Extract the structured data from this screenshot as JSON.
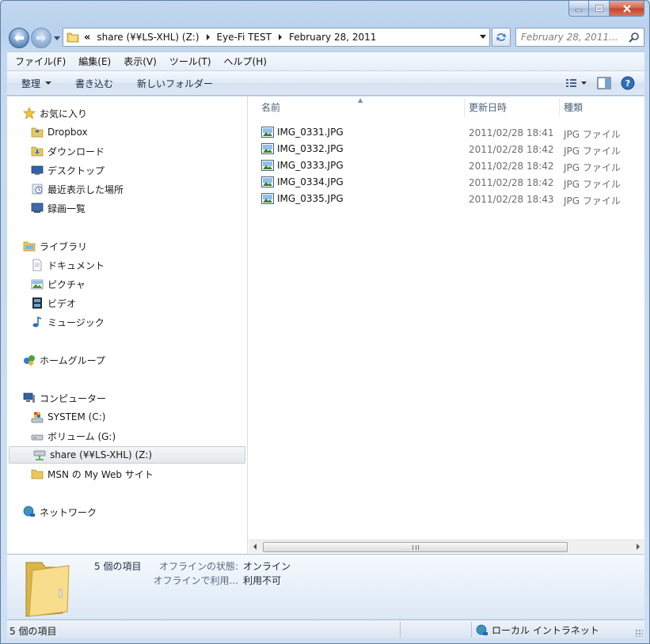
{
  "window": {
    "caption": {
      "minimize": "minimize",
      "maximize": "maximize",
      "close": "close"
    }
  },
  "address": {
    "overflow": "«",
    "crumbs": [
      "share (¥¥LS-XHL) (Z:)",
      "Eye-Fi TEST",
      "February 28, 2011"
    ]
  },
  "search": {
    "placeholder": "February 28, 2011..."
  },
  "menu": {
    "items": [
      "ファイル(F)",
      "編集(E)",
      "表示(V)",
      "ツール(T)",
      "ヘルプ(H)"
    ]
  },
  "toolbar": {
    "organize": "整理",
    "burn": "書き込む",
    "new_folder": "新しいフォルダー"
  },
  "navpane": {
    "favorites": {
      "label": "お気に入り",
      "items": [
        "Dropbox",
        "ダウンロード",
        "デスクトップ",
        "最近表示した場所",
        "録画一覧"
      ]
    },
    "libraries": {
      "label": "ライブラリ",
      "items": [
        "ドキュメント",
        "ピクチャ",
        "ビデオ",
        "ミュージック"
      ]
    },
    "homegroup": {
      "label": "ホームグループ"
    },
    "computer": {
      "label": "コンピューター",
      "items": [
        "SYSTEM (C:)",
        "ボリューム (G:)",
        "share (¥¥LS-XHL) (Z:)",
        "MSN の My Web サイト"
      ]
    },
    "network": {
      "label": "ネットワーク"
    }
  },
  "files": {
    "columns": {
      "name": "名前",
      "date": "更新日時",
      "type": "種類"
    },
    "rows": [
      {
        "name": "IMG_0331.JPG",
        "date": "2011/02/28 18:41",
        "type": "JPG ファイル"
      },
      {
        "name": "IMG_0332.JPG",
        "date": "2011/02/28 18:42",
        "type": "JPG ファイル"
      },
      {
        "name": "IMG_0333.JPG",
        "date": "2011/02/28 18:42",
        "type": "JPG ファイル"
      },
      {
        "name": "IMG_0334.JPG",
        "date": "2011/02/28 18:42",
        "type": "JPG ファイル"
      },
      {
        "name": "IMG_0335.JPG",
        "date": "2011/02/28 18:43",
        "type": "JPG ファイル"
      }
    ]
  },
  "details": {
    "count": "5 個の項目",
    "offline_status_label": "オフラインの状態:",
    "offline_status_value": "オンライン",
    "offline_use_label": "オフラインで利用...",
    "offline_use_value": "利用不可"
  },
  "status": {
    "count": "5 個の項目",
    "zone": "ローカル イントラネット"
  },
  "colors": {
    "frame": "#c2d8f0",
    "selected_row": "#e4e8ec",
    "close_button": "#c4442a"
  }
}
